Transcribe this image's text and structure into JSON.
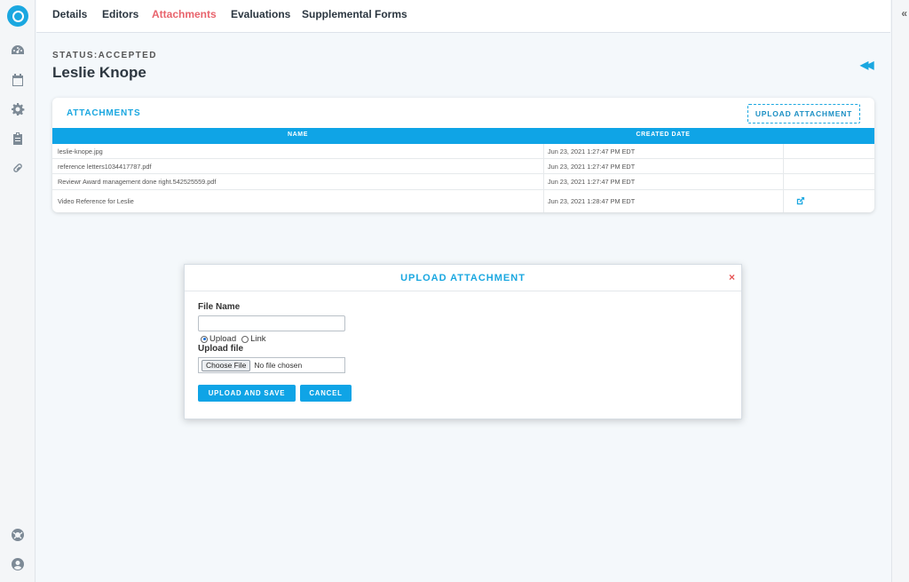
{
  "nav": {
    "tabs": [
      {
        "label": "Details"
      },
      {
        "label": "Editors"
      },
      {
        "label": "Attachments",
        "active": true
      },
      {
        "label": "Evaluations"
      },
      {
        "label": "Supplemental Forms"
      }
    ]
  },
  "header": {
    "status": "STATUS:ACCEPTED",
    "name": "Leslie Knope"
  },
  "attachments": {
    "title": "ATTACHMENTS",
    "upload_button": "UPLOAD ATTACHMENT",
    "columns": [
      "NAME",
      "CREATED DATE"
    ],
    "rows": [
      {
        "name": "leslie-knope.jpg",
        "created": "Jun 23, 2021 1:27:47 PM EDT"
      },
      {
        "name": "reference letters1034417787.pdf",
        "created": "Jun 23, 2021 1:27:47 PM EDT"
      },
      {
        "name": "Reviewr Award management done right.542525559.pdf",
        "created": "Jun 23, 2021 1:27:47 PM EDT"
      },
      {
        "name": "Video Reference for Leslie",
        "created": "Jun 23, 2021 1:28:47 PM EDT",
        "has_link": true
      }
    ]
  },
  "modal": {
    "title": "UPLOAD ATTACHMENT",
    "close": "×",
    "file_name_label": "File Name",
    "file_name_value": "",
    "radio_upload": "Upload",
    "radio_link": "Link",
    "selected": "Upload",
    "upload_file_label": "Upload file",
    "choose_file": "Choose File",
    "no_file": "No file chosen",
    "save_button": "UPLOAD AND SAVE",
    "cancel_button": "CANCEL"
  },
  "colors": {
    "accent": "#1aa7e0",
    "active_tab": "#e8636c",
    "table_header": "#0fa4e6",
    "close": "#e65454"
  }
}
